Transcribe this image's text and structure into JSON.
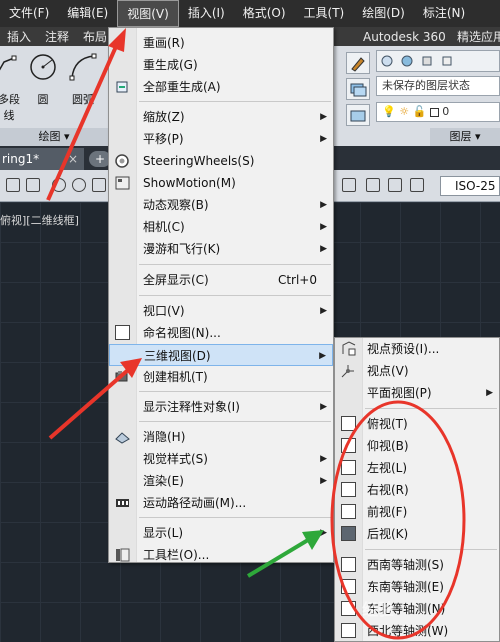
{
  "menubar": [
    "文件(F)",
    "编辑(E)",
    "视图(V)",
    "插入(I)",
    "格式(O)",
    "工具(T)",
    "绘图(D)",
    "标注(N)"
  ],
  "ribbon_tabs": [
    "插入",
    "注释",
    "布局"
  ],
  "ribbon_right_tabs": [
    "Autodesk 360",
    "精选应用"
  ],
  "ribbon": {
    "tools": [
      "多段线",
      "圆",
      "圆弧"
    ],
    "draw_panel": "绘图 ▾",
    "layer_state": "未保存的图层状态",
    "layer_current": "0",
    "layer_panel": "图层 ▾"
  },
  "doc_tab": {
    "name": "ring1*",
    "close": "×",
    "new": "+"
  },
  "toolbar2": {
    "dimstyle": "ISO-25"
  },
  "viewport_label": "俯视][二维线框]",
  "main_menu": [
    {
      "label": "重画(R)",
      "icon": "",
      "sub": false
    },
    {
      "label": "重生成(G)",
      "icon": "",
      "sub": false
    },
    {
      "label": "全部重生成(A)",
      "icon": "regen-all-icon",
      "sub": false
    },
    {
      "label": "缩放(Z)",
      "icon": "",
      "sub": true
    },
    {
      "label": "平移(P)",
      "icon": "",
      "sub": true
    },
    {
      "label": "SteeringWheels(S)",
      "icon": "steering-wheel-icon",
      "sub": false
    },
    {
      "label": "ShowMotion(M)",
      "icon": "showmotion-icon",
      "sub": false
    },
    {
      "label": "动态观察(B)",
      "icon": "",
      "sub": true
    },
    {
      "label": "相机(C)",
      "icon": "",
      "sub": true
    },
    {
      "label": "漫游和飞行(K)",
      "icon": "",
      "sub": true
    },
    {
      "label": "全屏显示(C)",
      "icon": "",
      "sub": false,
      "shortcut": "Ctrl+0"
    },
    {
      "label": "视口(V)",
      "icon": "",
      "sub": true
    },
    {
      "label": "命名视图(N)...",
      "icon": "named-view-icon",
      "sub": false
    },
    {
      "label": "三维视图(D)",
      "icon": "",
      "sub": true,
      "highlight": true
    },
    {
      "label": "创建相机(T)",
      "icon": "camera-icon",
      "sub": false
    },
    {
      "label": "显示注释性对象(I)",
      "icon": "",
      "sub": true
    },
    {
      "label": "消隐(H)",
      "icon": "hide-icon",
      "sub": false
    },
    {
      "label": "视觉样式(S)",
      "icon": "",
      "sub": true
    },
    {
      "label": "渲染(E)",
      "icon": "",
      "sub": true
    },
    {
      "label": "运动路径动画(M)...",
      "icon": "motion-path-icon",
      "sub": false
    },
    {
      "label": "显示(L)",
      "icon": "",
      "sub": true
    },
    {
      "label": "工具栏(O)...",
      "icon": "toolbar-icon",
      "sub": false
    }
  ],
  "sub_menu": [
    {
      "label": "视点预设(I)...",
      "icon": "viewpoint-preset-icon",
      "sub": false
    },
    {
      "label": "视点(V)",
      "icon": "viewpoint-icon",
      "sub": false
    },
    {
      "label": "平面视图(P)",
      "icon": "",
      "sub": true
    },
    {
      "label": "俯视(T)",
      "icon": "top-view-icon",
      "sub": false
    },
    {
      "label": "仰视(B)",
      "icon": "bottom-view-icon",
      "sub": false
    },
    {
      "label": "左视(L)",
      "icon": "left-view-icon",
      "sub": false
    },
    {
      "label": "右视(R)",
      "icon": "right-view-icon",
      "sub": false
    },
    {
      "label": "前视(F)",
      "icon": "front-view-icon",
      "sub": false
    },
    {
      "label": "后视(K)",
      "icon": "back-view-icon",
      "sub": false
    },
    {
      "label": "西南等轴测(S)",
      "icon": "sw-iso-icon",
      "sub": false
    },
    {
      "label": "东南等轴测(E)",
      "icon": "se-iso-icon",
      "sub": false
    },
    {
      "label": "东北等轴测(N)",
      "icon": "ne-iso-icon",
      "sub": false
    },
    {
      "label": "西北等轴测(W)",
      "icon": "nw-iso-icon",
      "sub": false
    }
  ],
  "watermark": "经验",
  "colors": {
    "menubar_bg": "#2d2d2d",
    "menu_bg": "#f1f1f1",
    "highlight_bg": "#cfe3f7",
    "annotation_red": "#e8352a",
    "annotation_green": "#2ea83a"
  }
}
